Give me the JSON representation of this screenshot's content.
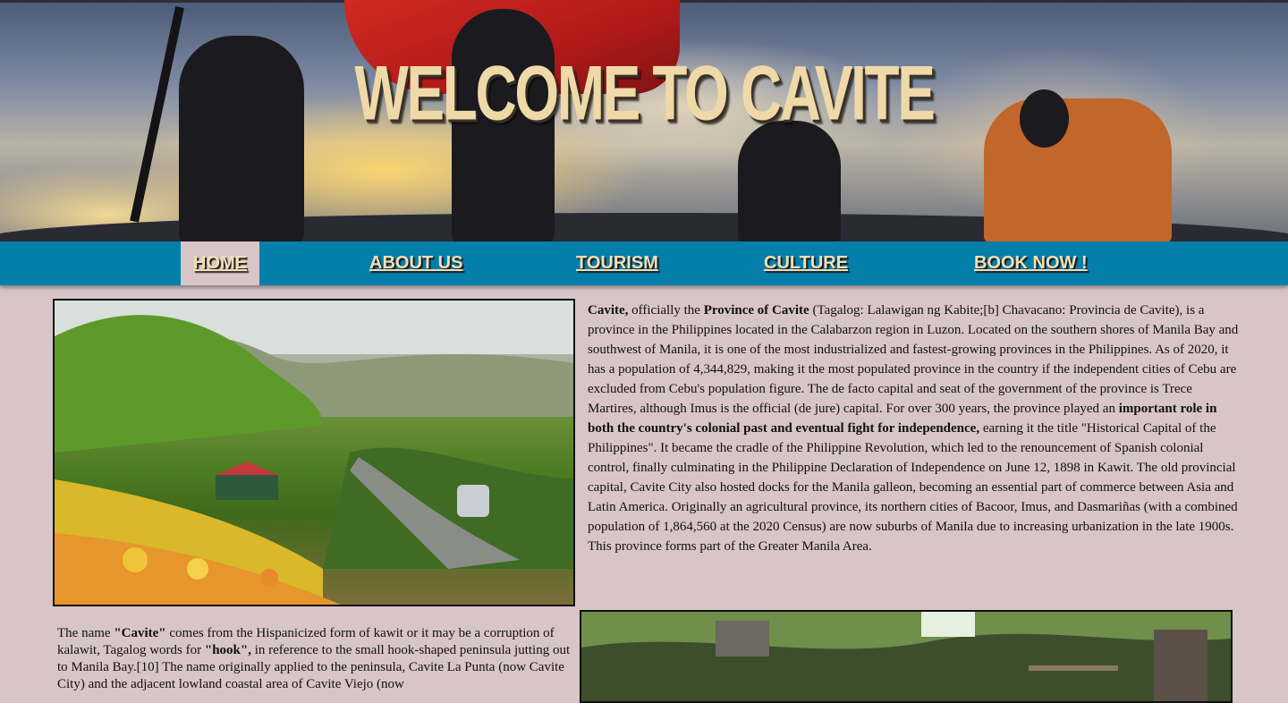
{
  "banner": {
    "title": "WELCOME TO CAVITE"
  },
  "nav": {
    "items": [
      {
        "label": "HOME",
        "active": true
      },
      {
        "label": "ABOUT US",
        "active": false
      },
      {
        "label": "TOURISM",
        "active": false
      },
      {
        "label": "CULTURE",
        "active": false
      },
      {
        "label": "BOOK NOW !",
        "active": false
      }
    ]
  },
  "intro": {
    "p1_bold": "Cavite,",
    "p2": " officially the ",
    "p3_bold": "Province of Cavite",
    "p4": " (Tagalog: Lalawigan ng Kabite;[b] Chavacano: Provincia de Cavite), is a province in the Philippines located in the Calabarzon region in Luzon. Located on the southern shores of Manila Bay and southwest of Manila, it is one of the most industrialized and fastest-growing provinces in the Philippines. As of 2020, it has a population of 4,344,829, making it the most populated province in the country if the independent cities of Cebu are excluded from Cebu's population figure. The de facto capital and seat of the government of the province is Trece Martires, although Imus is the official (de jure) capital. For over 300 years, the province played an ",
    "p5_bold": "important role in both the country's colonial past and eventual fight for independence,",
    "p6": " earning it the title \"Historical Capital of the Philippines\". It became the cradle of the Philippine Revolution, which led to the renouncement of Spanish colonial control, finally culminating in the Philippine Declaration of Independence on June 12, 1898 in Kawit. The old provincial capital, Cavite City also hosted docks for the Manila galleon, becoming an essential part of commerce between Asia and Latin America. Originally an agricultural province, its northern cities of Bacoor, Imus, and Dasmariñas (with a combined population of 1,864,560 at the 2020 Census) are now suburbs of Manila due to increasing urbanization in the late 1900s. This province forms part of the Greater Manila Area."
  },
  "name_origin": {
    "p1": "The name ",
    "p2_bold": "\"Cavite\"",
    "p3": " comes from the Hispanicized form of kawit or it may be a corruption of kalawit, Tagalog words for ",
    "p4_bold": "\"hook\",",
    "p5": " in reference to the small hook-shaped peninsula jutting out to Manila Bay.[10] The name originally applied to the peninsula, Cavite La Punta (now Cavite City) and the adjacent lowland coastal area of Cavite Viejo (now"
  }
}
